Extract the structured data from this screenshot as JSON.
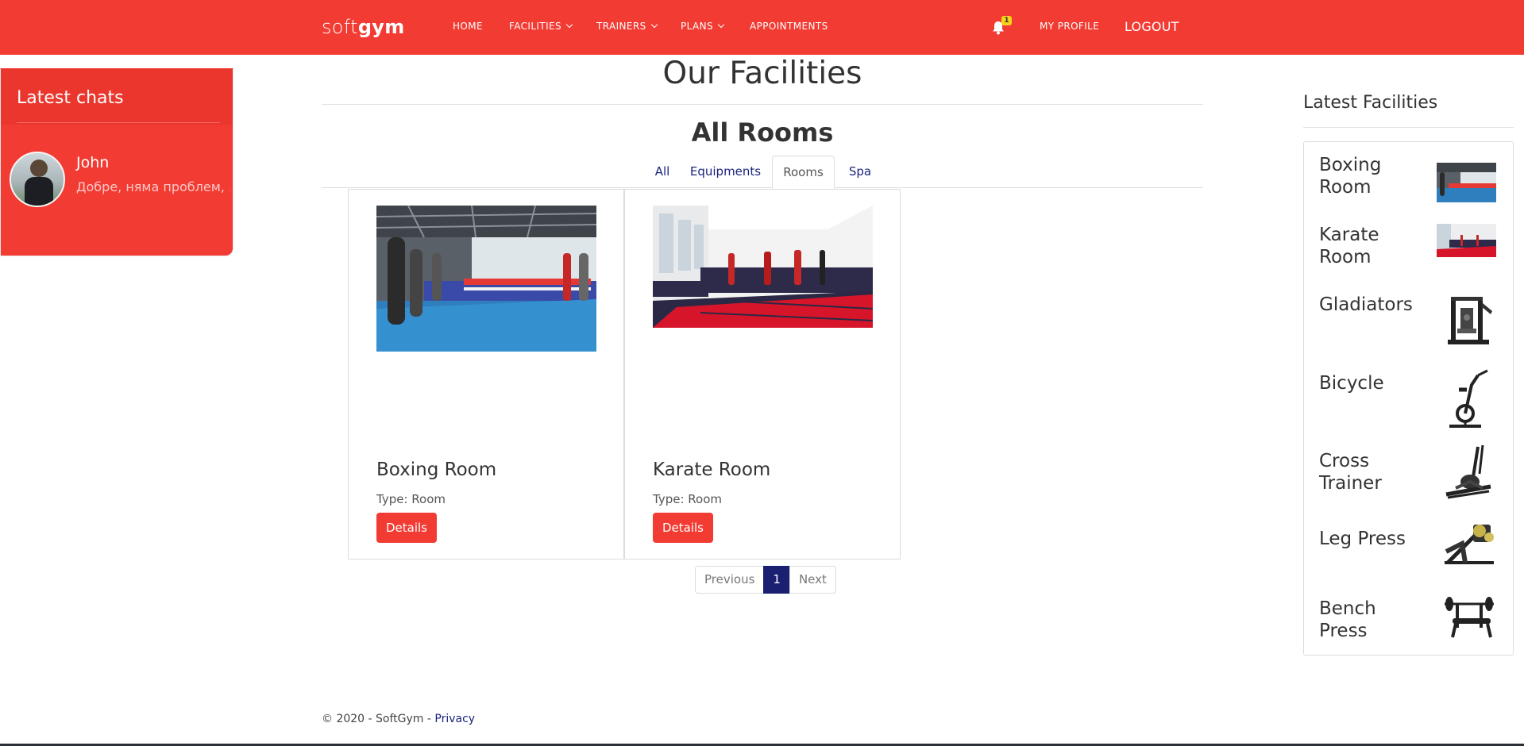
{
  "navbar": {
    "brand_light": "soft",
    "brand_bold": "gym",
    "links": [
      "HOME",
      "FACILITIES",
      "TRAINERS",
      "PLANS",
      "APPOINTMENTS"
    ],
    "notification_count": "1",
    "my_profile": "MY PROFILE",
    "logout": "LOGOUT"
  },
  "chats": {
    "title": "Latest chats",
    "items": [
      {
        "name": "John",
        "message": "Добре, няма проблем, ..."
      }
    ]
  },
  "main": {
    "title": "Our Facilities",
    "section_title": "All Rooms",
    "tabs": [
      "All",
      "Equipments",
      "Rooms",
      "Spa"
    ],
    "active_tab": "Rooms",
    "cards": [
      {
        "title": "Boxing Room",
        "type": "Type: Room",
        "button": "Details"
      },
      {
        "title": "Karate Room",
        "type": "Type: Room",
        "button": "Details"
      }
    ],
    "pagination": {
      "previous": "Previous",
      "current": "1",
      "next": "Next"
    }
  },
  "latest_facilities": {
    "title": "Latest Facilities",
    "items": [
      "Boxing Room",
      "Karate Room",
      "Gladiators",
      "Bicycle",
      "Cross Trainer",
      "Leg Press",
      "Bench Press"
    ]
  },
  "footer": {
    "text": "© 2020 - SoftGym - ",
    "privacy": "Privacy"
  },
  "colors": {
    "primary": "#f23b33",
    "active_page": "#1a1f71",
    "badge": "#f7d21a"
  }
}
